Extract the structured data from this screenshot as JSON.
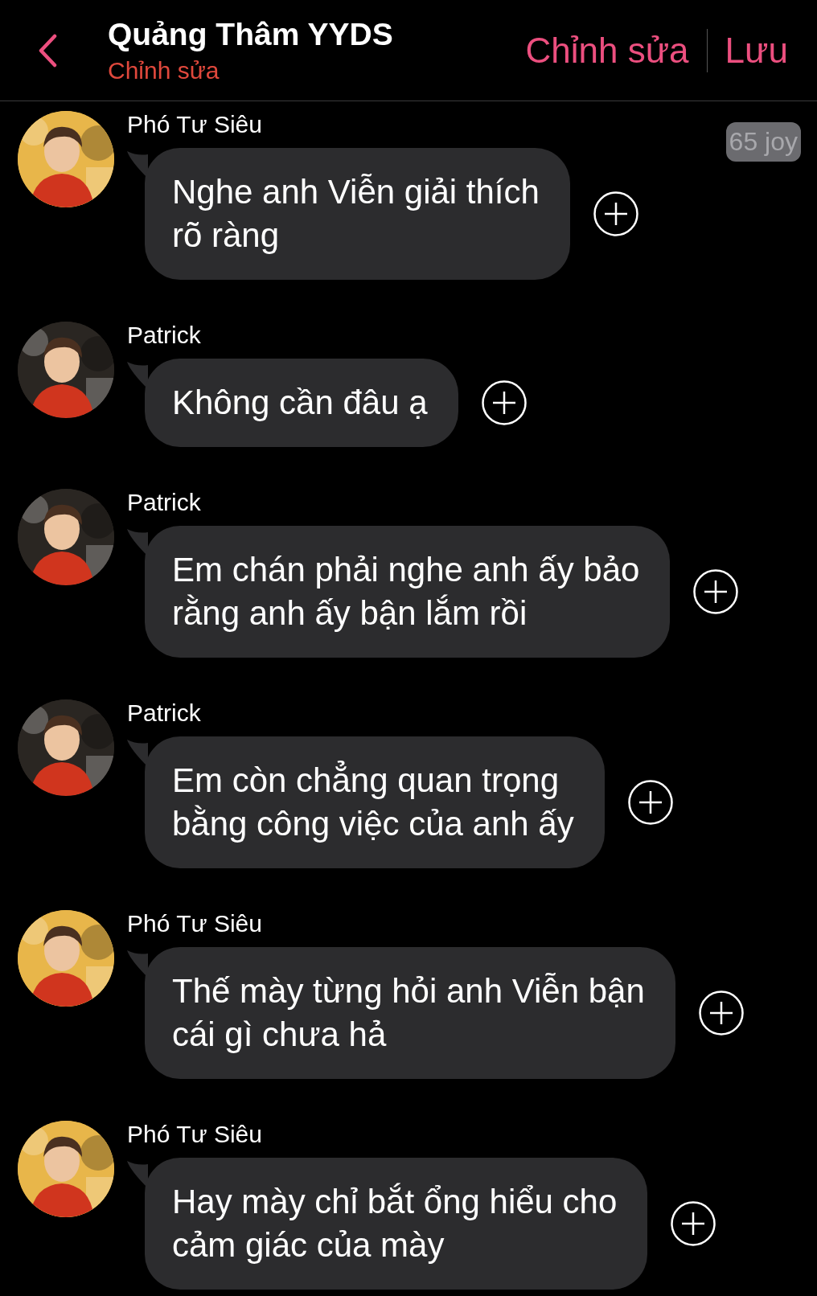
{
  "header": {
    "title": "Quảng Thâm YYDS",
    "subtitle": "Chỉnh sửa",
    "actions": [
      "Chỉnh sửa",
      "Lưu"
    ]
  },
  "badge": "65 joy",
  "messages": [
    {
      "sender": "Phó Tư Siêu",
      "color": "#e8b64a",
      "text": "Nghe anh Viễn giải thích\nrõ ràng"
    },
    {
      "sender": "Patrick",
      "color": "#2a2622",
      "text": "Không cần đâu ạ"
    },
    {
      "sender": "Patrick",
      "color": "#2a2622",
      "text": "Em chán phải nghe anh ấy bảo\nrằng anh ấy bận lắm rồi"
    },
    {
      "sender": "Patrick",
      "color": "#2a2622",
      "text": "Em còn chẳng quan trọng\nbằng công việc của anh ấy"
    },
    {
      "sender": "Phó Tư Siêu",
      "color": "#e8b64a",
      "text": "Thế mày từng hỏi anh Viễn bận\ncái gì chưa hả"
    },
    {
      "sender": "Phó Tư Siêu",
      "color": "#e8b64a",
      "text": "Hay mày chỉ bắt ổng hiểu cho\ncảm giác của mày"
    }
  ]
}
